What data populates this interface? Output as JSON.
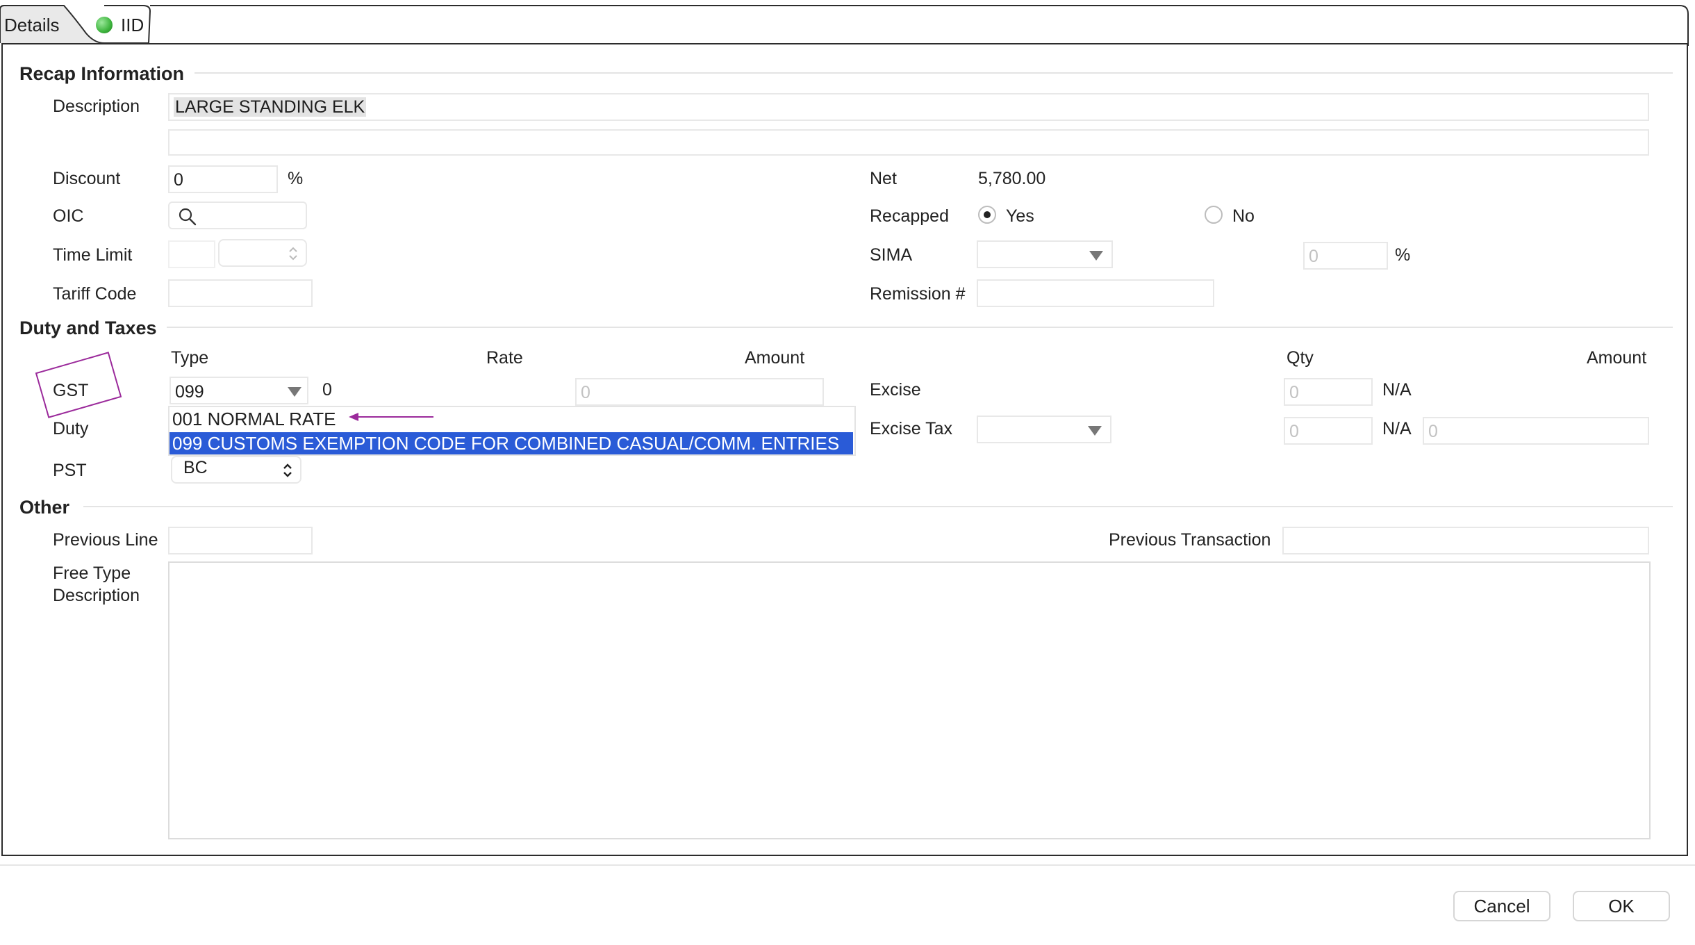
{
  "tabs": [
    {
      "label": "Details"
    },
    {
      "label": "IID"
    }
  ],
  "sections": {
    "recap": "Recap Information",
    "duty": "Duty and Taxes",
    "other": "Other"
  },
  "recap": {
    "description_label": "Description",
    "description_value": "LARGE STANDING ELK",
    "description_line2": "",
    "discount_label": "Discount",
    "discount_value": "0",
    "discount_unit": "%",
    "oic_label": "OIC",
    "time_limit_label": "Time Limit",
    "tariff_code_label": "Tariff Code",
    "net_label": "Net",
    "net_value": "5,780.00",
    "recapped_label": "Recapped",
    "recapped_yes": "Yes",
    "recapped_no": "No",
    "sima_label": "SIMA",
    "sima_pct_value": "0",
    "sima_pct_unit": "%",
    "remission_label": "Remission #"
  },
  "duty": {
    "col_type": "Type",
    "col_rate": "Rate",
    "col_amount": "Amount",
    "col_qty": "Qty",
    "col_amount2": "Amount",
    "gst_label": "GST",
    "gst_type": "099",
    "gst_rate": "0",
    "gst_amount": "0",
    "duty_label": "Duty",
    "pst_label": "PST",
    "pst_value": "BC",
    "excise_label": "Excise",
    "excise_qty": "0",
    "excise_na": "N/A",
    "excise_tax_label": "Excise Tax",
    "excise_tax_qty": "0",
    "excise_tax_na": "N/A",
    "excise_tax_amount": "0",
    "dropdown_options": [
      "001 NORMAL RATE",
      "099 CUSTOMS EXEMPTION CODE FOR COMBINED CASUAL/COMM. ENTRIES"
    ]
  },
  "other": {
    "previous_line_label": "Previous Line",
    "previous_transaction_label": "Previous Transaction",
    "free_type_label_1": "Free Type",
    "free_type_label_2": "Description"
  },
  "buttons": {
    "cancel": "Cancel",
    "ok": "OK"
  },
  "colors": {
    "selection": "#2a5bd7",
    "annotation": "#9b2a9b",
    "status_green": "#3db43d"
  },
  "icons": [
    "search-icon",
    "status-green-dot-icon",
    "dropdown-arrow-icon",
    "stepper-icon"
  ]
}
